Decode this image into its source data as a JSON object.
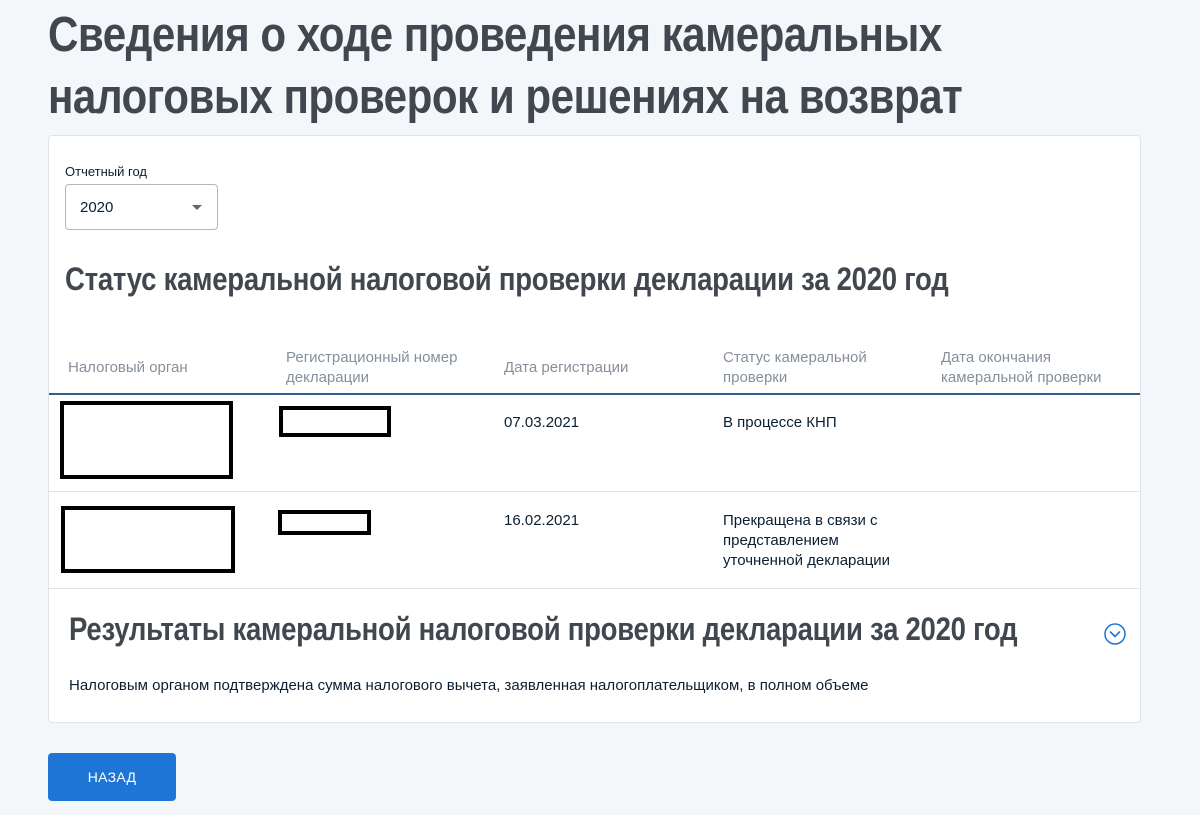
{
  "page": {
    "title": "Сведения о ходе проведения камеральных налоговых проверок и решениях на возврат"
  },
  "filter": {
    "year_label": "Отчетный год",
    "year_value": "2020"
  },
  "status_section": {
    "title": "Статус камеральной налоговой проверки декларации за 2020 год",
    "columns": [
      "Налоговый орган",
      "Регистрационный номер декларации",
      "Дата регистрации",
      "Статус камеральной проверки",
      "Дата окончания камеральной проверки"
    ],
    "rows": [
      {
        "registration_date": "07.03.2021",
        "status": "В процессе КНП",
        "end_date": ""
      },
      {
        "registration_date": "16.02.2021",
        "status": "Прекращена в связи с представлением уточненной декларации",
        "end_date": ""
      }
    ]
  },
  "results_section": {
    "title": "Результаты камеральной налоговой проверки декларации за 2020 год",
    "text": "Налоговым органом подтверждена сумма налогового вычета, заявленная налогоплательщиком, в полном объеме",
    "toggle_icon": "chevron-down-circle-icon"
  },
  "actions": {
    "back_label": "НАЗАД"
  },
  "colors": {
    "accent": "#1f75d6",
    "title": "#41474e",
    "header_text": "#86909c",
    "background": "#f4f7fa"
  }
}
